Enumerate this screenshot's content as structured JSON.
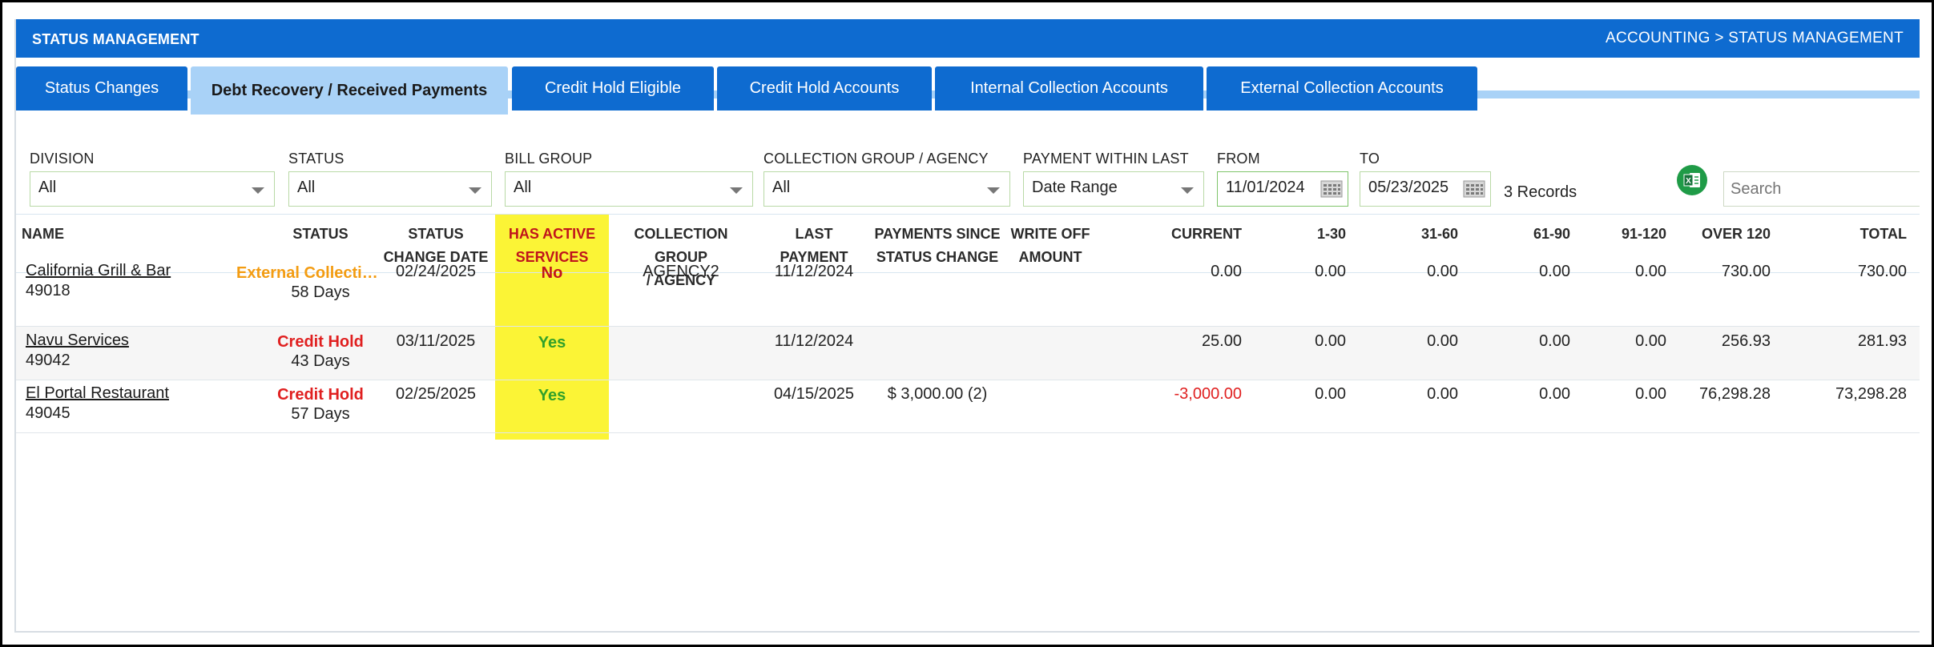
{
  "header": {
    "title": "STATUS MANAGEMENT",
    "breadcrumb": "ACCOUNTING > STATUS MANAGEMENT"
  },
  "tabs": [
    {
      "label": "Status Changes",
      "active": false
    },
    {
      "label": "Debt Recovery / Received Payments",
      "active": true
    },
    {
      "label": "Credit Hold Eligible",
      "active": false
    },
    {
      "label": "Credit Hold Accounts",
      "active": false
    },
    {
      "label": "Internal Collection Accounts",
      "active": false
    },
    {
      "label": "External Collection Accounts",
      "active": false
    }
  ],
  "filters": {
    "division": {
      "label": "DIVISION",
      "value": "All"
    },
    "status": {
      "label": "STATUS",
      "value": "All"
    },
    "bill_group": {
      "label": "BILL GROUP",
      "value": "All"
    },
    "collection_group": {
      "label": "COLLECTION GROUP / AGENCY",
      "value": "All"
    },
    "payment_within": {
      "label": "PAYMENT WITHIN LAST",
      "value": "Date Range"
    },
    "from": {
      "label": "FROM",
      "value": "11/01/2024"
    },
    "to": {
      "label": "TO",
      "value": "05/23/2025"
    },
    "records": "3 Records",
    "search_placeholder": "Search"
  },
  "columns": {
    "name": "NAME",
    "status": "STATUS",
    "status_change_1": "STATUS",
    "status_change_2": "CHANGE DATE",
    "has_active_1": "HAS ACTIVE",
    "has_active_2": "SERVICES",
    "collection_1": "COLLECTION GROUP",
    "collection_2": "/ AGENCY",
    "last_payment": "LAST PAYMENT",
    "payments_since_1": "PAYMENTS SINCE",
    "payments_since_2": "STATUS CHANGE",
    "write_off_1": "WRITE OFF",
    "write_off_2": "AMOUNT",
    "current": "CURRENT",
    "d1_30": "1-30",
    "d31_60": "31-60",
    "d61_90": "61-90",
    "d91_120": "91-120",
    "over120": "OVER 120",
    "total": "TOTAL"
  },
  "rows": [
    {
      "name": "California Grill & Bar",
      "id": "49018",
      "status": "External Collecti…",
      "status_color": "#f39c12",
      "days": "58 Days",
      "change_date": "02/24/2025",
      "has_active": "No",
      "collection": "AGENCY2",
      "last_payment": "11/12/2024",
      "payments_since": "",
      "write_off": "",
      "current": "0.00",
      "d1_30": "0.00",
      "d31_60": "0.00",
      "d61_90": "0.00",
      "d91_120": "0.00",
      "over120": "730.00",
      "total": "730.00"
    },
    {
      "name": "Navu Services",
      "id": "49042",
      "status": "Credit Hold",
      "status_color": "#e02020",
      "days": "43 Days",
      "change_date": "03/11/2025",
      "has_active": "Yes",
      "collection": "",
      "last_payment": "11/12/2024",
      "payments_since": "",
      "write_off": "",
      "current": "25.00",
      "d1_30": "0.00",
      "d31_60": "0.00",
      "d61_90": "0.00",
      "d91_120": "0.00",
      "over120": "256.93",
      "total": "281.93"
    },
    {
      "name": "El Portal Restaurant",
      "id": "49045",
      "status": "Credit Hold",
      "status_color": "#e02020",
      "days": "57 Days",
      "change_date": "02/25/2025",
      "has_active": "Yes",
      "collection": "",
      "last_payment": "04/15/2025",
      "payments_since": "$ 3,000.00 (2)",
      "write_off": "",
      "current": "-3,000.00",
      "d1_30": "0.00",
      "d31_60": "0.00",
      "d61_90": "0.00",
      "d91_120": "0.00",
      "over120": "76,298.28",
      "total": "73,298.28"
    }
  ],
  "colors": {
    "header_blue": "#0e6bd0",
    "active_tab": "#a9d2f7",
    "highlight_yellow": "#fbf436"
  }
}
